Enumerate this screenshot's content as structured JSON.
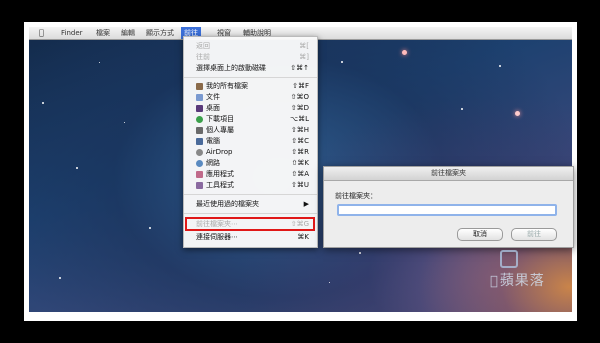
{
  "menubar": {
    "apple_icon": "apple-icon",
    "items": [
      "Finder",
      "檔案",
      "編輯",
      "顯示方式",
      "前往",
      "視窗",
      "輔助說明"
    ],
    "active_index": 4
  },
  "go_menu": {
    "items": [
      {
        "label": "返回",
        "shortcut": "⌘[",
        "disabled": true
      },
      {
        "label": "往前",
        "shortcut": "⌘]",
        "disabled": true
      },
      {
        "label": "選擇桌面上的啟動磁碟",
        "shortcut": "⇧⌘↑",
        "disabled": false
      },
      {
        "label": "我的所有檔案",
        "shortcut": "⇧⌘F",
        "icon": "all-files-icon",
        "icon_color": "#8a6a4a"
      },
      {
        "label": "文件",
        "shortcut": "⇧⌘O",
        "icon": "documents-icon",
        "icon_color": "#7a9ad0"
      },
      {
        "label": "桌面",
        "shortcut": "⇧⌘D",
        "icon": "desktop-icon",
        "icon_color": "#5a3a7a"
      },
      {
        "label": "下載項目",
        "shortcut": "⌥⌘L",
        "icon": "downloads-icon",
        "icon_color": "#3aa04a"
      },
      {
        "label": "個人專屬",
        "shortcut": "⇧⌘H",
        "icon": "home-icon",
        "icon_color": "#6a6a6a"
      },
      {
        "label": "電腦",
        "shortcut": "⇧⌘C",
        "icon": "computer-icon",
        "icon_color": "#4a6a9a"
      },
      {
        "label": "AirDrop",
        "shortcut": "⇧⌘R",
        "icon": "airdrop-icon",
        "icon_color": "#888888"
      },
      {
        "label": "網路",
        "shortcut": "⇧⌘K",
        "icon": "network-icon",
        "icon_color": "#5a8ac0"
      },
      {
        "label": "應用程式",
        "shortcut": "⇧⌘A",
        "icon": "applications-icon",
        "icon_color": "#c06a8a"
      },
      {
        "label": "工具程式",
        "shortcut": "⇧⌘U",
        "icon": "utilities-icon",
        "icon_color": "#8a6aa0"
      },
      {
        "label": "最近使用過的檔案夾",
        "shortcut": "▶",
        "disabled": false
      },
      {
        "label": "前往檔案夾⋯",
        "shortcut": "⇧⌘G",
        "disabled": true
      },
      {
        "label": "連接伺服器⋯",
        "shortcut": "⌘K",
        "disabled": false
      }
    ]
  },
  "dialog": {
    "title": "前往檔案夾",
    "field_label": "前往檔案夾：",
    "input_value": "",
    "cancel_label": "取消",
    "go_label": "前往"
  },
  "watermark": {
    "text": "蘋果落"
  },
  "colors": {
    "highlight": "#e01818",
    "menu_active": "#3b6fd8",
    "input_focus": "#8fb3ea"
  }
}
